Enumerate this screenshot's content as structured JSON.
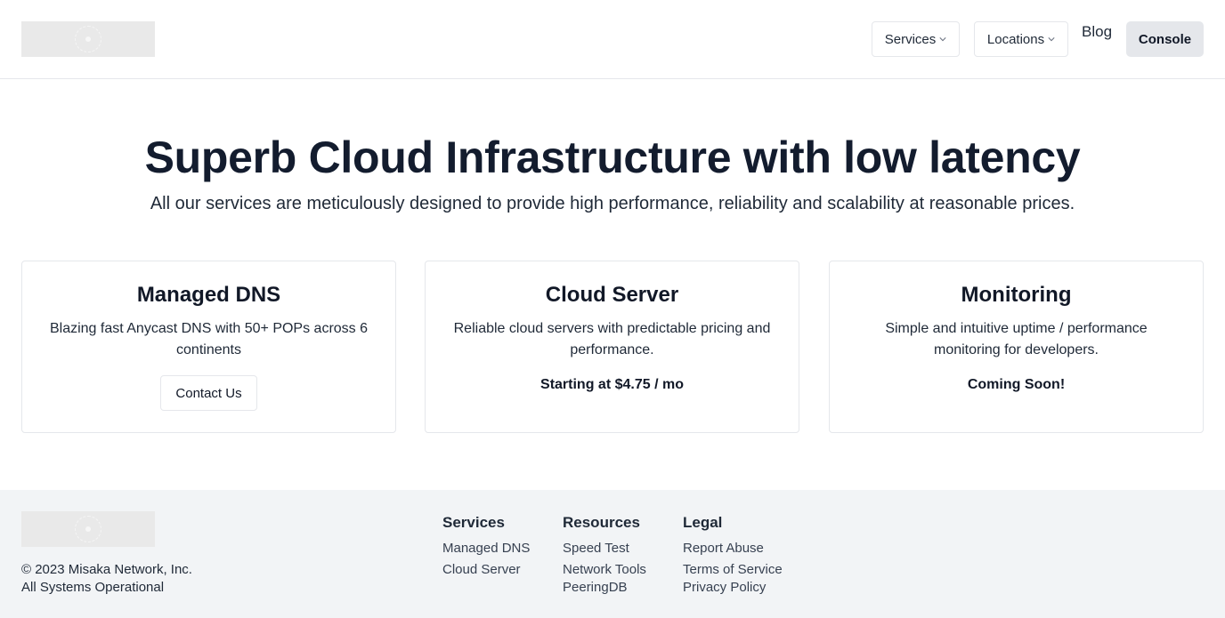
{
  "header": {
    "nav": {
      "services_label": "Services",
      "locations_label": "Locations",
      "blog_label": "Blog",
      "console_label": "Console"
    }
  },
  "hero": {
    "title": "Superb Cloud Infrastructure with low latency",
    "subtitle": "All our services are meticulously designed to provide high performance, reliability and scalability at reasonable prices."
  },
  "cards": [
    {
      "title": "Managed DNS",
      "description": "Blazing fast Anycast DNS with 50+ POPs across 6 continents",
      "button_label": "Contact Us"
    },
    {
      "title": "Cloud Server",
      "description": "Reliable cloud servers with predictable pricing and performance.",
      "extra": "Starting at $4.75 / mo"
    },
    {
      "title": "Monitoring",
      "description": "Simple and intuitive uptime / performance monitoring for developers.",
      "extra": "Coming Soon!"
    }
  ],
  "footer": {
    "copyright": "© 2023 Misaka Network, Inc.",
    "status": "All Systems Operational",
    "columns": [
      {
        "title": "Services",
        "links": [
          "Managed DNS",
          "Cloud Server"
        ]
      },
      {
        "title": "Resources",
        "links": [
          "Speed Test",
          "Network Tools",
          "PeeringDB"
        ]
      },
      {
        "title": "Legal",
        "links": [
          "Report Abuse",
          "Terms of Service",
          "Privacy Policy"
        ]
      }
    ]
  },
  "colors": {
    "text_primary": "#111827",
    "border": "#e5e7eb",
    "footer_bg": "#f2f4f6",
    "console_bg": "#e5e7eb"
  },
  "icons": [
    "logo-image",
    "chevron-down-icon"
  ]
}
